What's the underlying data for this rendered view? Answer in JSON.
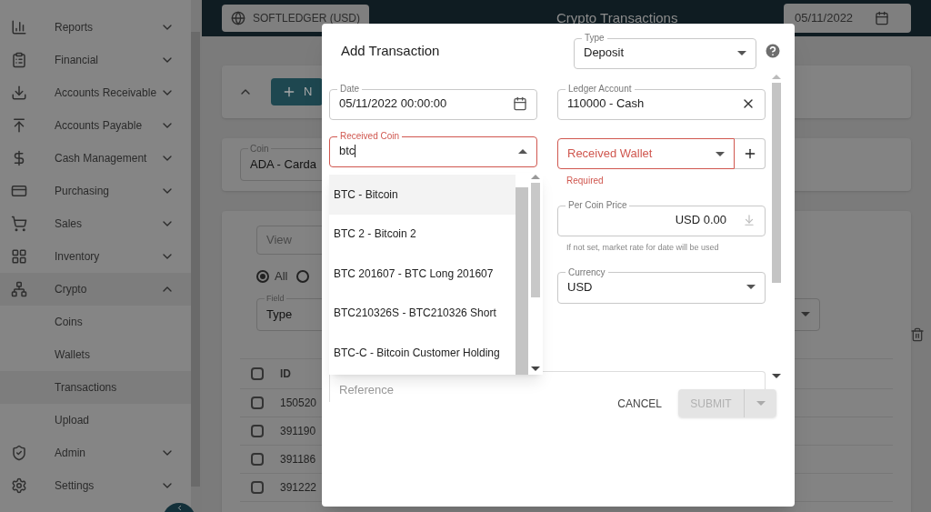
{
  "sidebar": {
    "items": [
      {
        "label": "Reports",
        "expanded": false
      },
      {
        "label": "Financial",
        "expanded": false
      },
      {
        "label": "Accounts Receivable",
        "expanded": false
      },
      {
        "label": "Accounts Payable",
        "expanded": false
      },
      {
        "label": "Cash Management",
        "expanded": false
      },
      {
        "label": "Purchasing",
        "expanded": false
      },
      {
        "label": "Sales",
        "expanded": false
      },
      {
        "label": "Inventory",
        "expanded": false
      },
      {
        "label": "Crypto",
        "expanded": true,
        "children": [
          {
            "label": "Coins",
            "selected": false
          },
          {
            "label": "Wallets",
            "selected": false
          },
          {
            "label": "Transactions",
            "selected": true
          },
          {
            "label": "Upload",
            "selected": false
          }
        ]
      },
      {
        "label": "Admin",
        "expanded": false
      },
      {
        "label": "Settings",
        "expanded": false
      }
    ]
  },
  "header": {
    "company": "SOFTLEDGER (USD)",
    "title": "Crypto Transactions",
    "date": "05/11/2022"
  },
  "background": {
    "new_button": "N",
    "coin": {
      "label": "Coin",
      "value": "ADA - Carda"
    },
    "view_placeholder": "View",
    "radios": [
      {
        "label": "All",
        "selected": true
      },
      {
        "selected": false
      }
    ],
    "field": {
      "label": "Field",
      "value": "Type"
    },
    "table": {
      "columns": [
        "ID"
      ],
      "all_checked": false,
      "rows": [
        {
          "id": "150520",
          "checked": false
        },
        {
          "id": "391190",
          "checked": false
        },
        {
          "id": "391186",
          "checked": false
        },
        {
          "id": "391222",
          "checked": false
        }
      ]
    }
  },
  "dialog": {
    "title": "Add Transaction",
    "type": {
      "label": "Type",
      "value": "Deposit"
    },
    "date": {
      "label": "Date",
      "value": "05/11/2022 00:00:00"
    },
    "ledger_account": {
      "label": "Ledger Account",
      "value": "110000 - Cash"
    },
    "received_coin": {
      "label": "Received Coin",
      "value": "btc",
      "error": true,
      "options": [
        {
          "label": "BTC - Bitcoin",
          "selected": true
        },
        {
          "label": "BTC 2 - Bitcoin 2",
          "selected": false
        },
        {
          "label": "BTC 201607 - BTC Long 201607",
          "selected": false
        },
        {
          "label": "BTC210326S - BTC210326 Short",
          "selected": false
        },
        {
          "label": "BTC-C - Bitcoin Customer Holding",
          "selected": false
        }
      ]
    },
    "received_wallet": {
      "placeholder": "Received Wallet",
      "error": true,
      "helper": "Required"
    },
    "per_coin_price": {
      "label": "Per Coin Price",
      "value": "USD 0.00",
      "helper": "If not set, market rate for date will be used"
    },
    "currency": {
      "label": "Currency",
      "value": "USD"
    },
    "reference": {
      "placeholder": "Reference"
    },
    "buttons": {
      "cancel": "CANCEL",
      "submit": "SUBMIT",
      "submit_disabled": true
    }
  }
}
